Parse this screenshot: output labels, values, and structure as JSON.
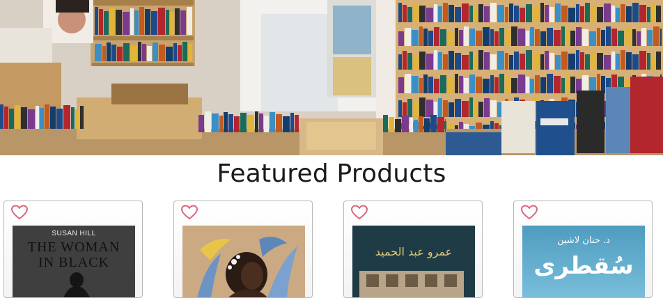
{
  "hero": {
    "image_alt": "Bookstore interior with shelves and display tables of books",
    "shelf_colors": [
      "#1e4a8a",
      "#b3262d",
      "#1b6b5a",
      "#e1b43a",
      "#2f2f2f",
      "#7a3b8f",
      "#f0ede5",
      "#3c8fc5",
      "#c45a1e",
      "#153d6b"
    ]
  },
  "section": {
    "title": "Featured Products"
  },
  "products": [
    {
      "favorite_icon": "heart-outline-icon",
      "cover": {
        "author": "SUSAN HILL",
        "title_line1": "THE WOMAN",
        "title_line2": "IN BLACK",
        "bg": "#3f3f3f"
      }
    },
    {
      "favorite_icon": "heart-outline-icon",
      "cover": {
        "bg": "#c9ad8c"
      }
    },
    {
      "favorite_icon": "heart-outline-icon",
      "cover": {
        "author": "عمرو عبد الحميد",
        "bg": "#1e3a44"
      }
    },
    {
      "favorite_icon": "heart-outline-icon",
      "cover": {
        "author": "د. حنان لاشين",
        "title": "سُقطرى",
        "bg": "#5fa9c9"
      }
    }
  ],
  "colors": {
    "heart": "#d9667a",
    "card_border": "#b8b8b8",
    "title": "#1a1a1a"
  }
}
